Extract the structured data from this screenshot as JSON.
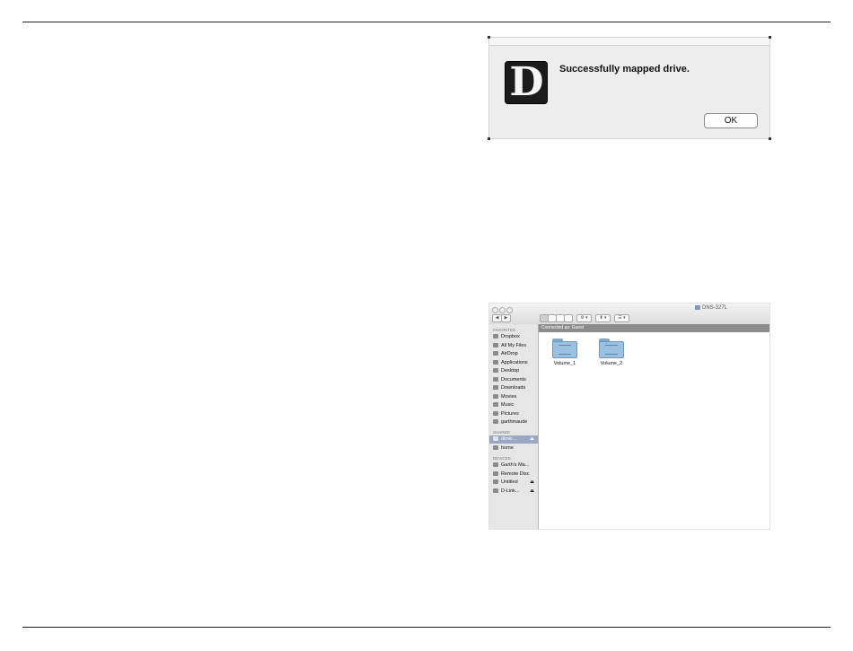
{
  "dialog": {
    "logo_letter": "D",
    "message": "Successfully mapped drive.",
    "ok_label": "OK"
  },
  "finder": {
    "window_title": "DNS-327L",
    "toolbar": {
      "back_label": "◀",
      "forward_label": "▶",
      "action_label": "⚙ ▾",
      "share_label": "⬍ ▾",
      "arrange_label": "☰ ▾"
    },
    "path_bar": "Connected as: Guest",
    "sidebar": {
      "favorites_header": "FAVORITES",
      "favorites": [
        {
          "label": "Dropbox",
          "icon": "dropbox-icon"
        },
        {
          "label": "All My Files",
          "icon": "all-files-icon"
        },
        {
          "label": "AirDrop",
          "icon": "airdrop-icon"
        },
        {
          "label": "Applications",
          "icon": "applications-icon"
        },
        {
          "label": "Desktop",
          "icon": "desktop-icon"
        },
        {
          "label": "Documents",
          "icon": "documents-icon"
        },
        {
          "label": "Downloads",
          "icon": "downloads-icon"
        },
        {
          "label": "Movies",
          "icon": "movies-icon"
        },
        {
          "label": "Music",
          "icon": "music-icon"
        },
        {
          "label": "Pictures",
          "icon": "pictures-icon"
        },
        {
          "label": "garthmaude",
          "icon": "home-icon"
        }
      ],
      "shared_header": "SHARED",
      "shared": [
        {
          "label": "dlinkr...",
          "icon": "server-icon",
          "eject": "⏏",
          "selected": true
        },
        {
          "label": "home",
          "icon": "network-icon"
        }
      ],
      "devices_header": "DEVICES",
      "devices": [
        {
          "label": "Garth's Ma...",
          "icon": "computer-icon"
        },
        {
          "label": "Remote Disc",
          "icon": "disc-icon"
        },
        {
          "label": "Untitled",
          "icon": "drive-icon",
          "eject": "⏏"
        },
        {
          "label": "D-Link...",
          "icon": "drive-icon",
          "eject": "⏏"
        }
      ]
    },
    "folders": [
      {
        "label": "Volume_1"
      },
      {
        "label": "Volume_2"
      }
    ]
  }
}
